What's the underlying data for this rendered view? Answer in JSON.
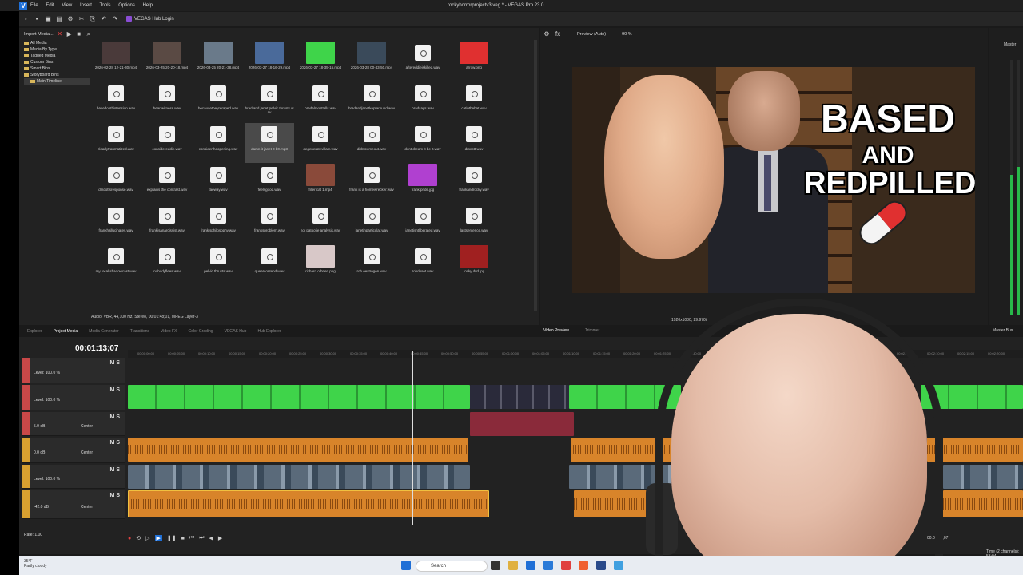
{
  "window": {
    "title": "rockyhorrorprojectv3.veg * - VEGAS Pro 23.0",
    "menu": [
      "File",
      "Edit",
      "View",
      "Insert",
      "Tools",
      "Options",
      "Help"
    ],
    "hub_label": "VEGAS Hub Login"
  },
  "explorer": {
    "import_label": "Import Media...",
    "tree": [
      "All Media",
      "Media By Type",
      "Tagged Media",
      "Custom Bins",
      "Smart Bins",
      "Storyboard Bins",
      "Main Timeline"
    ],
    "items": [
      {
        "label": "2026-02-28 12-21-30.mp4",
        "kind": "video",
        "color": "#4a3a3a"
      },
      {
        "label": "2026-03-25 20-20-18.mp4",
        "kind": "video",
        "color": "#5a4a44"
      },
      {
        "label": "2026-03-25 20-21-38.mp4",
        "kind": "video",
        "color": "#6a7a8a"
      },
      {
        "label": "2026-03-27 18-16-29.mp4",
        "kind": "video",
        "color": "#4a6a9a"
      },
      {
        "label": "2026-03-27 18-35-15.mp4",
        "kind": "video",
        "color": "#3fd44a"
      },
      {
        "label": "2026-03-28 00-43-50.mp4",
        "kind": "video",
        "color": "#3a4a5a"
      },
      {
        "label": "aftereddieiskilled.wav",
        "kind": "wav"
      },
      {
        "label": "arrow.png",
        "kind": "image",
        "color": "#e03030"
      },
      {
        "label": "basedonthistension.wav",
        "kind": "wav"
      },
      {
        "label": "bear witness.wav",
        "kind": "wav"
      },
      {
        "label": "becausetheyreraped.wav",
        "kind": "wav"
      },
      {
        "label": "brad and janet pelvic thrusts.wav",
        "kind": "wav"
      },
      {
        "label": "bradalmosttells.wav",
        "kind": "wav"
      },
      {
        "label": "bradandjanetkeptaround.wav",
        "kind": "wav"
      },
      {
        "label": "bradsays.wav",
        "kind": "wav"
      },
      {
        "label": "catinthehat.wav",
        "kind": "wav"
      },
      {
        "label": "clearlytraumatized.wav",
        "kind": "wav"
      },
      {
        "label": "considereddie.wav",
        "kind": "wav"
      },
      {
        "label": "considertheopening.wav",
        "kind": "wav"
      },
      {
        "label": "damn it janet 0 b0.mp3",
        "kind": "wav",
        "selected": true
      },
      {
        "label": "degeneratevillain.wav",
        "kind": "wav"
      },
      {
        "label": "didntcomeout.wav",
        "kind": "wav"
      },
      {
        "label": "dont dream it be it.wav",
        "kind": "wav"
      },
      {
        "label": "drscott.wav",
        "kind": "wav"
      },
      {
        "label": "drscottsresponse.wav",
        "kind": "wav"
      },
      {
        "label": "explains the contrast.wav",
        "kind": "wav"
      },
      {
        "label": "faeway.wav",
        "kind": "wav"
      },
      {
        "label": "feelsgood.wav",
        "kind": "wav"
      },
      {
        "label": "filler cat 1.mp4",
        "kind": "video",
        "color": "#8a4a3a"
      },
      {
        "label": "frank is a homewrecker.wav",
        "kind": "wav"
      },
      {
        "label": "frank pride.jpg",
        "kind": "image",
        "color": "#b040d0"
      },
      {
        "label": "frankandrocky.wav",
        "kind": "wav"
      },
      {
        "label": "frankhallucinates.wav",
        "kind": "wav"
      },
      {
        "label": "frankisanarcissist.wav",
        "kind": "wav"
      },
      {
        "label": "frankisphilosophy.wav",
        "kind": "wav"
      },
      {
        "label": "franksproblem.wav",
        "kind": "wav"
      },
      {
        "label": "hot patootie analysis.wav",
        "kind": "wav"
      },
      {
        "label": "janetinparticular.wav",
        "kind": "wav"
      },
      {
        "label": "janetisntliberated.wav",
        "kind": "wav"
      },
      {
        "label": "lastsentence.wav",
        "kind": "wav"
      },
      {
        "label": "my local shadowcast.wav",
        "kind": "wav"
      },
      {
        "label": "nobodyflees.wav",
        "kind": "wav"
      },
      {
        "label": "pelvic thrusts.wav",
        "kind": "wav"
      },
      {
        "label": "queercontend.wav",
        "kind": "wav"
      },
      {
        "label": "richard o brien.png",
        "kind": "image",
        "color": "#d8c8c8"
      },
      {
        "label": "rob oestrogen.wav",
        "kind": "wav"
      },
      {
        "label": "robdoset.wav",
        "kind": "wav"
      },
      {
        "label": "rocky dvd.jpg",
        "kind": "image",
        "color": "#a02020"
      }
    ],
    "status": "Audio: VBR, 44,100 Hz, Stereo, 00:01:48;01, MPEG Layer-3"
  },
  "tabs": [
    "Explorer",
    "Project Media",
    "Media Generator",
    "Transitions",
    "Video FX",
    "Color Grading",
    "VEGAS Hub",
    "Hub Explorer"
  ],
  "active_tab": "Project Media",
  "preview": {
    "mode": "Preview (Auto)",
    "zoom": "90 %",
    "headline1": "BASED",
    "headline2": "AND",
    "headline3": "REDPILLED",
    "status": "1920x1080, 29.970i",
    "tabs": [
      "Video Preview",
      "Trimmer"
    ],
    "master_label": "Master",
    "master_bus": "Master Bus"
  },
  "timeline": {
    "timecode": "00:01:13;07",
    "tracks": [
      {
        "level": "Level: 100.0 %",
        "color": "#c84848"
      },
      {
        "level": "Level: 100.0 %",
        "color": "#c84848"
      },
      {
        "level": "5.0 dB",
        "pan": "Center",
        "color": "#c84848"
      },
      {
        "level": "0.0 dB",
        "pan": "Center",
        "color": "#d8a030"
      },
      {
        "level": "Level: 100.0 %",
        "color": "#d8a030"
      },
      {
        "level": "-42.0 dB",
        "pan": "Center",
        "color": "#d8a030"
      }
    ],
    "ms": "M S",
    "rate": "Rate: 1.00",
    "end_time": "00:01:13;07",
    "ticks": [
      "00:00:00;00",
      "00:00:05;00",
      "00:00:10;00",
      "00:00:15;00",
      "00:00:20;00",
      "00:00:25;00",
      "00:00:30;00",
      "00:00:35;00",
      "00:00:40;00",
      "00:00:45;00",
      "00:00:50;00",
      "00:00:55;00",
      "00:01:00;00",
      "00:01:05;00",
      "00:01:10;00",
      "00:01:15;00",
      "00:01:20;00",
      "00:01:25;00",
      "00:01:30;00",
      "00:01:35;00",
      "00:01:40;00",
      "00:01:45;00",
      "00:01:50;00",
      "00:01:55;00",
      "00:02:00;00",
      "00:02:05;00",
      "00:02:10;00",
      "00:02:15;00",
      "00:02:20;00"
    ]
  },
  "taskbar": {
    "temp": "35°F",
    "condition": "Partly cloudy",
    "search": "Search",
    "time_label": "Time (2 channels): 53:04"
  }
}
